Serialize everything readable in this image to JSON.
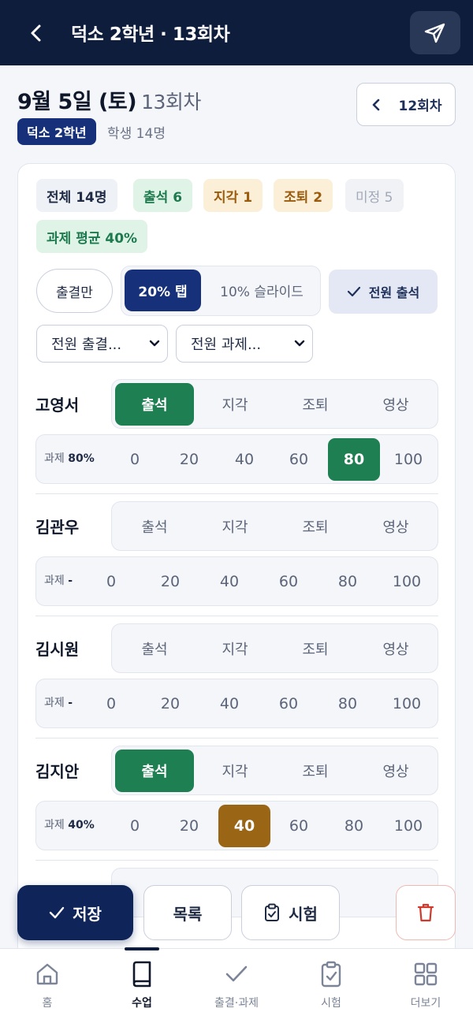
{
  "topbar": {
    "title": "덕소 2학년 · 13회차"
  },
  "header": {
    "date": "9월 5일 (토)",
    "session": "13회차",
    "prev_session": "12회차",
    "class_name": "덕소 2학년",
    "student_count": "학생 14명"
  },
  "summary": {
    "total": "전체 14명",
    "attend": "출석 6",
    "late": "지각 1",
    "early": "조퇴 2",
    "undecided": "미정 5",
    "homework_avg": "과제 평균 40%"
  },
  "controls": {
    "attendance_only": "출결만",
    "tap_20": "20% 탭",
    "slide_10": "10% 슬라이드",
    "all_attend": "전원 출석",
    "select_attendance": "전원 출결...",
    "select_homework": "전원 과제..."
  },
  "attendance_options": [
    "출석",
    "지각",
    "조퇴",
    "영상"
  ],
  "homework_options": [
    "0",
    "20",
    "40",
    "60",
    "80",
    "100"
  ],
  "students": [
    {
      "name": "고영서",
      "status": "출석",
      "homework_prefix": "과제 ",
      "homework_value": "80%"
    },
    {
      "name": "김관우",
      "status": "",
      "homework_prefix": "과제 ",
      "homework_value": "-"
    },
    {
      "name": "김시원",
      "status": "",
      "homework_prefix": "과제 ",
      "homework_value": "-"
    },
    {
      "name": "김지안",
      "status": "출석",
      "homework_prefix": "과제 ",
      "homework_value": "40%"
    }
  ],
  "actions": {
    "save": "저장",
    "list": "목록",
    "exam": "시험"
  },
  "tabs": [
    "홈",
    "수업",
    "출결·과제",
    "시험",
    "더보기"
  ],
  "colors": {
    "navy": "#0f1d3d",
    "green": "#1d7f52",
    "brown": "#9a6514",
    "accent": "#16307a"
  }
}
